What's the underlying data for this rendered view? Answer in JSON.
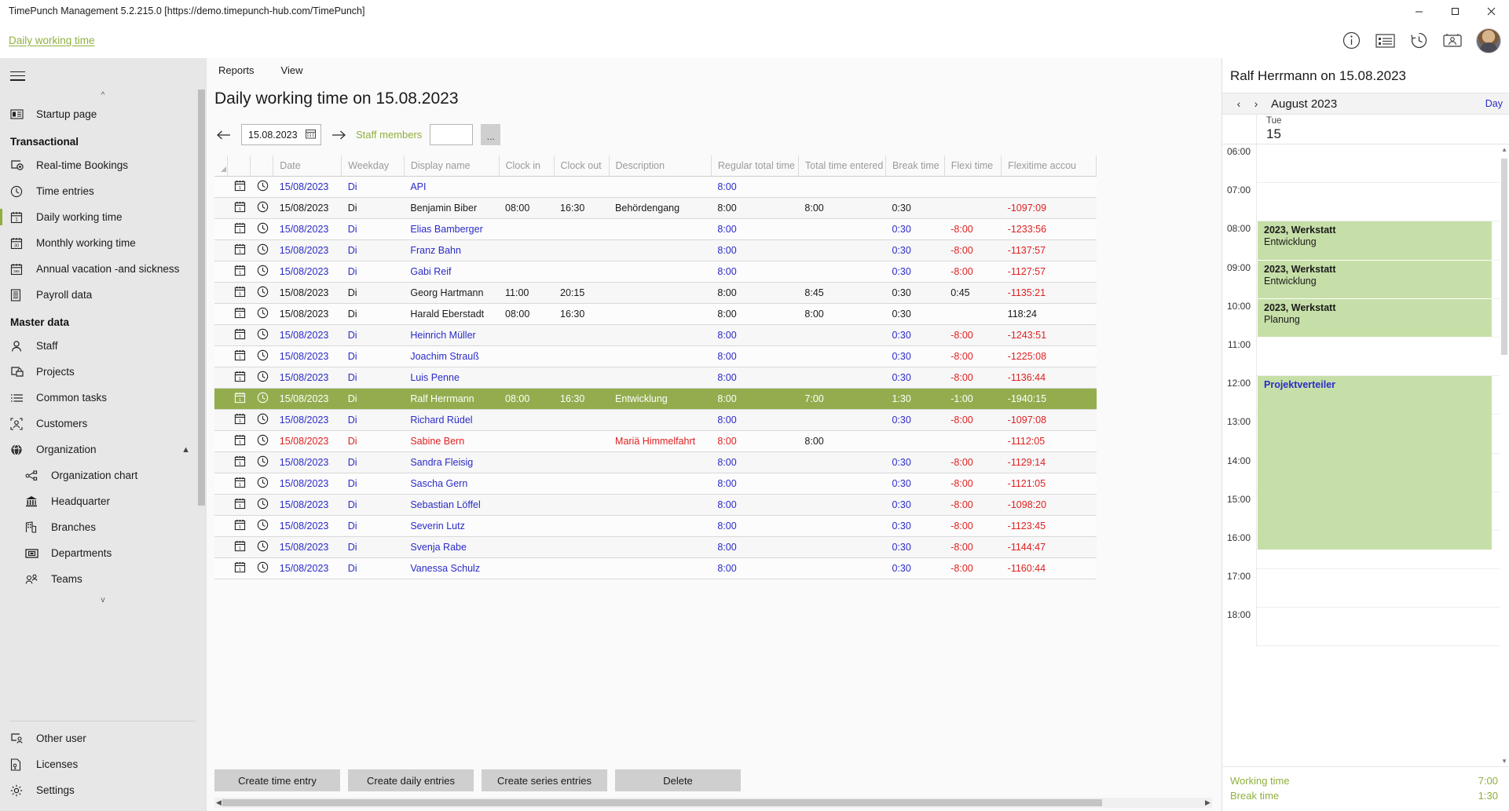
{
  "window": {
    "title": "TimePunch Management 5.2.215.0 [https://demo.timepunch-hub.com/TimePunch]",
    "minimize": "minimize-icon",
    "maximize": "maximize-icon",
    "close": "close-icon"
  },
  "header": {
    "breadcrumb": "Daily working time",
    "icons": [
      "info-icon",
      "list-icon",
      "history-icon",
      "kiosk-icon"
    ],
    "avatar": "user-avatar"
  },
  "sidebar": {
    "menu_toggle": "hamburger-icon",
    "top_item": {
      "label": "Startup page",
      "icon": "startup-page-icon"
    },
    "groups": [
      {
        "title": "Transactional",
        "items": [
          {
            "label": "Real-time Bookings",
            "icon": "realtime-bookings-icon",
            "active": false
          },
          {
            "label": "Time entries",
            "icon": "clock-icon",
            "active": false
          },
          {
            "label": "Daily working time",
            "icon": "calendar-day-icon",
            "active": true
          },
          {
            "label": "Monthly working time",
            "icon": "calendar-month-icon",
            "active": false
          },
          {
            "label": "Annual vacation -and sickness",
            "icon": "calendar-year-icon",
            "active": false
          },
          {
            "label": "Payroll data",
            "icon": "payroll-icon",
            "active": false
          }
        ]
      },
      {
        "title": "Master data",
        "items": [
          {
            "label": "Staff",
            "icon": "person-icon",
            "active": false
          },
          {
            "label": "Projects",
            "icon": "projects-icon",
            "active": false
          },
          {
            "label": "Common tasks",
            "icon": "tasks-list-icon",
            "active": false
          },
          {
            "label": "Customers",
            "icon": "customers-icon",
            "active": false
          },
          {
            "label": "Organization",
            "icon": "globe-icon",
            "active": false,
            "expanded": true,
            "chevron": "chevron-up-icon"
          },
          {
            "label": "Organization chart",
            "icon": "org-chart-icon",
            "sub": true
          },
          {
            "label": "Headquarter",
            "icon": "headquarter-icon",
            "sub": true
          },
          {
            "label": "Branches",
            "icon": "branches-icon",
            "sub": true
          },
          {
            "label": "Departments",
            "icon": "departments-icon",
            "sub": true
          },
          {
            "label": "Teams",
            "icon": "teams-icon",
            "sub": true
          }
        ]
      }
    ],
    "bottom_items": [
      {
        "label": "Other user",
        "icon": "other-user-icon"
      },
      {
        "label": "Licenses",
        "icon": "license-icon"
      },
      {
        "label": "Settings",
        "icon": "gear-icon"
      }
    ]
  },
  "main": {
    "menu": [
      "Reports",
      "View"
    ],
    "page_title": "Daily working time on 15.08.2023",
    "filter": {
      "prev_icon": "arrow-left-icon",
      "date_value": "15.08.2023",
      "calendar_icon": "calendar-icon",
      "next_icon": "arrow-right-icon",
      "staff_label": "Staff members",
      "staff_value": "",
      "more_button": "..."
    },
    "columns": [
      "",
      "",
      "",
      "Date",
      "Weekday",
      "Display name",
      "Clock in",
      "Clock out",
      "Description",
      "Regular total time",
      "Total time entered",
      "Break time",
      "Flexi time",
      "Flexitime accou"
    ],
    "rows": [
      {
        "date": "15/08/2023",
        "weekday": "Di",
        "name": "API",
        "in": "",
        "out": "",
        "desc": "",
        "regular": "8:00",
        "total": "",
        "break": "",
        "flexi": "",
        "account": "",
        "style": "link"
      },
      {
        "date": "15/08/2023",
        "weekday": "Di",
        "name": "Benjamin Biber",
        "in": "08:00",
        "out": "16:30",
        "desc": "Behördengang",
        "regular": "8:00",
        "total": "8:00",
        "break": "0:30",
        "flexi": "",
        "account": "-1097:09",
        "style": "plain"
      },
      {
        "date": "15/08/2023",
        "weekday": "Di",
        "name": "Elias Bamberger",
        "in": "",
        "out": "",
        "desc": "",
        "regular": "8:00",
        "total": "",
        "break": "0:30",
        "flexi": "-8:00",
        "account": "-1233:56",
        "style": "link"
      },
      {
        "date": "15/08/2023",
        "weekday": "Di",
        "name": "Franz Bahn",
        "in": "",
        "out": "",
        "desc": "",
        "regular": "8:00",
        "total": "",
        "break": "0:30",
        "flexi": "-8:00",
        "account": "-1137:57",
        "style": "link"
      },
      {
        "date": "15/08/2023",
        "weekday": "Di",
        "name": "Gabi Reif",
        "in": "",
        "out": "",
        "desc": "",
        "regular": "8:00",
        "total": "",
        "break": "0:30",
        "flexi": "-8:00",
        "account": "-1127:57",
        "style": "link"
      },
      {
        "date": "15/08/2023",
        "weekday": "Di",
        "name": "Georg Hartmann",
        "in": "11:00",
        "out": "20:15",
        "desc": "",
        "regular": "8:00",
        "total": "8:45",
        "break": "0:30",
        "flexi": "0:45",
        "account": "-1135:21",
        "style": "plain"
      },
      {
        "date": "15/08/2023",
        "weekday": "Di",
        "name": "Harald Eberstadt",
        "in": "08:00",
        "out": "16:30",
        "desc": "",
        "regular": "8:00",
        "total": "8:00",
        "break": "0:30",
        "flexi": "",
        "account": "118:24",
        "style": "plain"
      },
      {
        "date": "15/08/2023",
        "weekday": "Di",
        "name": "Heinrich  Müller",
        "in": "",
        "out": "",
        "desc": "",
        "regular": "8:00",
        "total": "",
        "break": "0:30",
        "flexi": "-8:00",
        "account": "-1243:51",
        "style": "link"
      },
      {
        "date": "15/08/2023",
        "weekday": "Di",
        "name": "Joachim Strauß",
        "in": "",
        "out": "",
        "desc": "",
        "regular": "8:00",
        "total": "",
        "break": "0:30",
        "flexi": "-8:00",
        "account": "-1225:08",
        "style": "link"
      },
      {
        "date": "15/08/2023",
        "weekday": "Di",
        "name": "Luis Penne",
        "in": "",
        "out": "",
        "desc": "",
        "regular": "8:00",
        "total": "",
        "break": "0:30",
        "flexi": "-8:00",
        "account": "-1136:44",
        "style": "link"
      },
      {
        "date": "15/08/2023",
        "weekday": "Di",
        "name": "Ralf Herrmann",
        "in": "08:00",
        "out": "16:30",
        "desc": "Entwicklung",
        "regular": "8:00",
        "total": "7:00",
        "break": "1:30",
        "flexi": "-1:00",
        "account": "-1940:15",
        "style": "selected"
      },
      {
        "date": "15/08/2023",
        "weekday": "Di",
        "name": "Richard Rüdel",
        "in": "",
        "out": "",
        "desc": "",
        "regular": "8:00",
        "total": "",
        "break": "0:30",
        "flexi": "-8:00",
        "account": "-1097:08",
        "style": "link"
      },
      {
        "date": "15/08/2023",
        "weekday": "Di",
        "name": "Sabine Bern",
        "in": "",
        "out": "",
        "desc": "Mariä Himmelfahrt",
        "regular": "8:00",
        "total": "8:00",
        "break": "",
        "flexi": "",
        "account": "-1112:05",
        "style": "red"
      },
      {
        "date": "15/08/2023",
        "weekday": "Di",
        "name": "Sandra Fleisig",
        "in": "",
        "out": "",
        "desc": "",
        "regular": "8:00",
        "total": "",
        "break": "0:30",
        "flexi": "-8:00",
        "account": "-1129:14",
        "style": "link"
      },
      {
        "date": "15/08/2023",
        "weekday": "Di",
        "name": "Sascha Gern",
        "in": "",
        "out": "",
        "desc": "",
        "regular": "8:00",
        "total": "",
        "break": "0:30",
        "flexi": "-8:00",
        "account": "-1121:05",
        "style": "link"
      },
      {
        "date": "15/08/2023",
        "weekday": "Di",
        "name": "Sebastian Löffel",
        "in": "",
        "out": "",
        "desc": "",
        "regular": "8:00",
        "total": "",
        "break": "0:30",
        "flexi": "-8:00",
        "account": "-1098:20",
        "style": "link"
      },
      {
        "date": "15/08/2023",
        "weekday": "Di",
        "name": "Severin Lutz",
        "in": "",
        "out": "",
        "desc": "",
        "regular": "8:00",
        "total": "",
        "break": "0:30",
        "flexi": "-8:00",
        "account": "-1123:45",
        "style": "link"
      },
      {
        "date": "15/08/2023",
        "weekday": "Di",
        "name": "Svenja Rabe",
        "in": "",
        "out": "",
        "desc": "",
        "regular": "8:00",
        "total": "",
        "break": "0:30",
        "flexi": "-8:00",
        "account": "-1144:47",
        "style": "link"
      },
      {
        "date": "15/08/2023",
        "weekday": "Di",
        "name": "Vanessa Schulz",
        "in": "",
        "out": "",
        "desc": "",
        "regular": "8:00",
        "total": "",
        "break": "0:30",
        "flexi": "-8:00",
        "account": "-1160:44",
        "style": "link"
      }
    ],
    "buttons": [
      "Create time entry",
      "Create daily entries",
      "Create series entries",
      "Delete"
    ]
  },
  "rightpanel": {
    "title": "Ralf Herrmann on 15.08.2023",
    "prev_icon": "chevron-left-icon",
    "next_icon": "chevron-right-icon",
    "month": "August 2023",
    "view_link": "Day",
    "day_of_week": "Tue",
    "day_number": "15",
    "hours": [
      "06:00",
      "07:00",
      "08:00",
      "09:00",
      "10:00",
      "11:00",
      "12:00",
      "13:00",
      "14:00",
      "15:00",
      "16:00",
      "17:00",
      "18:00"
    ],
    "events": [
      {
        "title": "2023, Werkstatt",
        "subtitle": "Entwicklung",
        "start": "08:00",
        "end": "09:00",
        "color": "#c6dfa8",
        "style": "normal"
      },
      {
        "title": "2023, Werkstatt",
        "subtitle": "Entwicklung",
        "start": "09:00",
        "end": "10:00",
        "color": "#c6dfa8",
        "style": "normal"
      },
      {
        "title": "2023, Werkstatt",
        "subtitle": "Planung",
        "start": "10:00",
        "end": "11:00",
        "color": "#c6dfa8",
        "style": "normal"
      },
      {
        "title": "Projektverteiler",
        "subtitle": "",
        "start": "12:00",
        "end": "16:30",
        "color": "#c6dfa8",
        "style": "blueish"
      }
    ],
    "footer": [
      {
        "label": "Working time",
        "value": "7:00"
      },
      {
        "label": "Break time",
        "value": "1:30"
      }
    ]
  }
}
